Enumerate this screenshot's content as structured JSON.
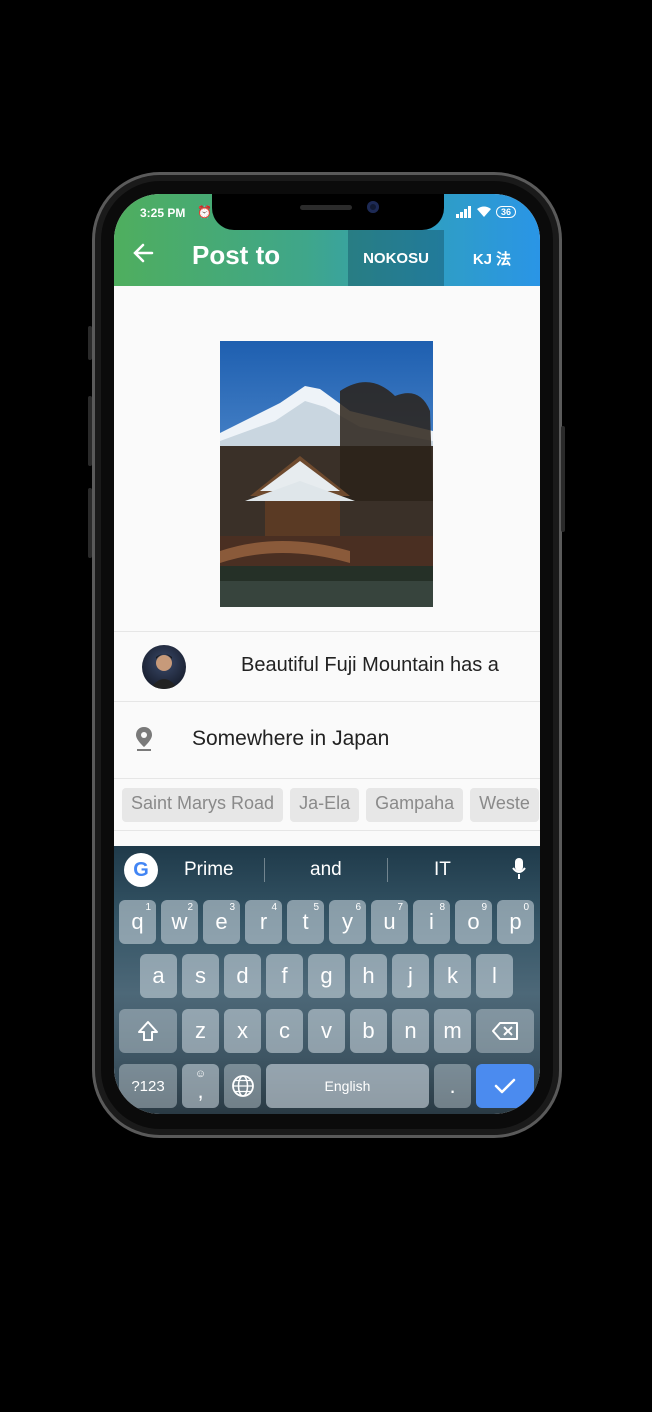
{
  "status_bar": {
    "time": "3:25 PM",
    "battery": "36",
    "alarm_icon": "alarm-icon",
    "signal_icon": "signal-icon",
    "wifi_icon": "wifi-icon"
  },
  "app_bar": {
    "title": "Post to",
    "actions": [
      "NOKOSU",
      "KJ 法"
    ],
    "back_icon": "arrow-left-icon"
  },
  "post": {
    "caption": "Beautiful Fuji Mountain has a",
    "location": "Somewhere in Japan",
    "location_suggestions": [
      "Saint Marys Road",
      "Ja-Ela",
      "Gampaha",
      "Weste"
    ]
  },
  "keyboard": {
    "suggestions": [
      "Prime",
      "and",
      "IT"
    ],
    "row1": [
      "q",
      "w",
      "e",
      "r",
      "t",
      "y",
      "u",
      "i",
      "o",
      "p"
    ],
    "row1_numbers": [
      "1",
      "2",
      "3",
      "4",
      "5",
      "6",
      "7",
      "8",
      "9",
      "0"
    ],
    "row2": [
      "a",
      "s",
      "d",
      "f",
      "g",
      "h",
      "j",
      "k",
      "l"
    ],
    "row3": [
      "z",
      "x",
      "c",
      "v",
      "b",
      "n",
      "m"
    ],
    "symbols_key": "?123",
    "comma_key": ",",
    "period_key": ".",
    "space_label": "English"
  },
  "colors": {
    "appbar_start": "#4fae5e",
    "appbar_end": "#2a95e6",
    "enter_key": "#4b8bef"
  }
}
